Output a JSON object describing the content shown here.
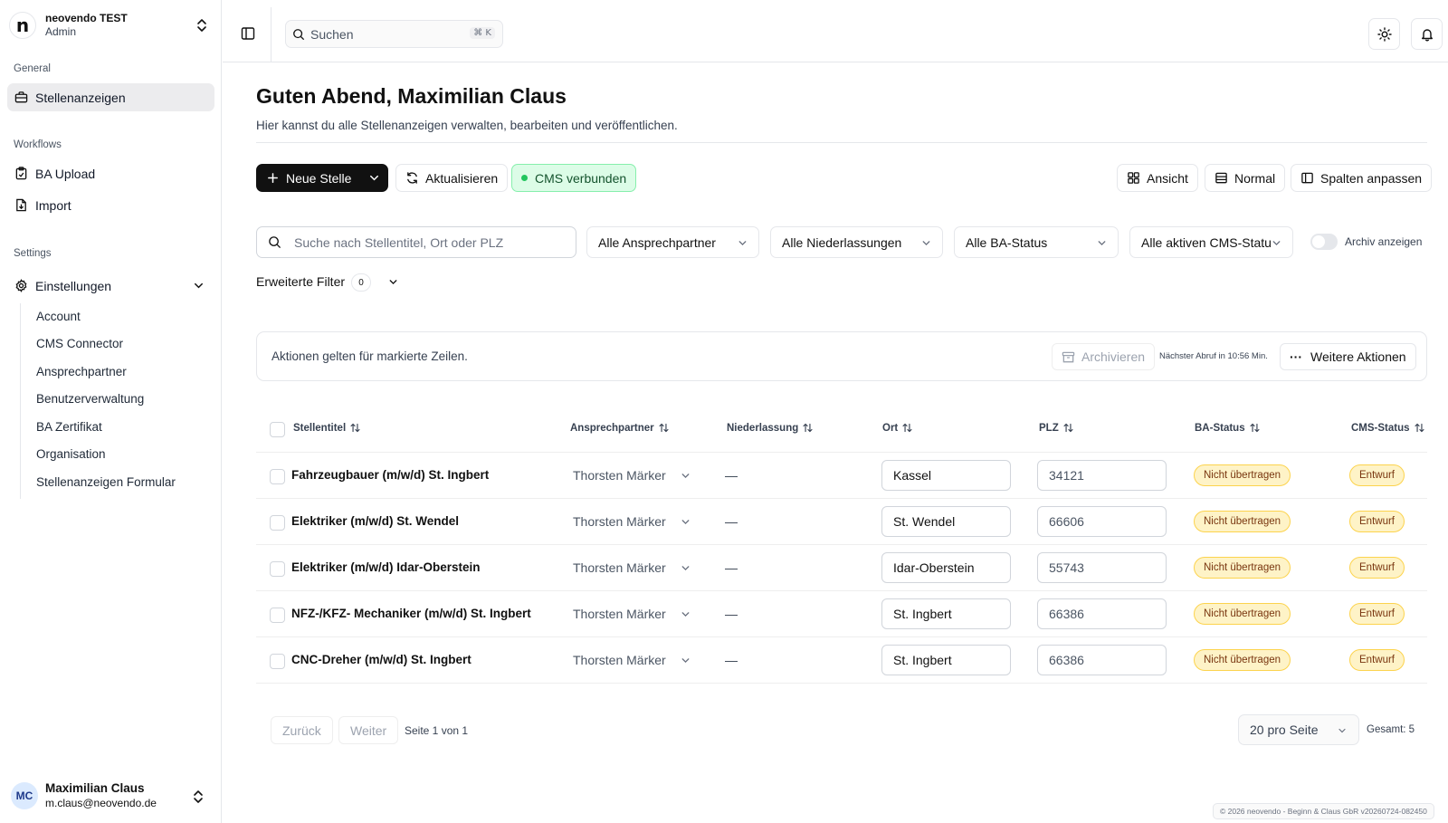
{
  "brand": {
    "name": "neovendo TEST",
    "role": "Admin",
    "logo_letter": "n"
  },
  "sidebar": {
    "general_label": "General",
    "jobs_label": "Stellenanzeigen",
    "workflows_label": "Workflows",
    "ba_upload_label": "BA Upload",
    "import_label": "Import",
    "settings_label": "Settings",
    "settings_item_label": "Einstellungen",
    "sub_items": [
      "Account",
      "CMS Connector",
      "Ansprechpartner",
      "Benutzerverwaltung",
      "BA Zertifikat",
      "Organisation",
      "Stellenanzeigen Formular"
    ]
  },
  "user": {
    "initials": "MC",
    "name": "Maximilian Claus",
    "email": "m.claus@neovendo.de"
  },
  "header": {
    "search_placeholder": "Suchen",
    "shortcut": "⌘ K"
  },
  "main": {
    "title": "Guten Abend, Maximilian Claus",
    "subtitle": "Hier kannst du alle Stellenanzeigen verwalten, bearbeiten und veröffentlichen.",
    "new_job_label": "Neue Stelle",
    "refresh_label": "Aktualisieren",
    "cms_status_label": "CMS verbunden",
    "view_label": "Ansicht",
    "density_label": "Normal",
    "columns_label": "Spalten anpassen"
  },
  "filters": {
    "search_placeholder": "Suche nach Stellentitel, Ort oder PLZ",
    "contact": "Alle Ansprechpartner",
    "branch": "Alle Niederlassungen",
    "ba_status": "Alle BA-Status",
    "cms_status": "Alle aktiven CMS-Status",
    "archive_toggle_label": "Archiv anzeigen",
    "archive_toggle_on": false,
    "advanced_label": "Erweiterte Filter",
    "advanced_count": "0"
  },
  "actions": {
    "hint": "Aktionen gelten für markierte Zeilen.",
    "archive_label": "Archivieren",
    "next_fetch": "Nächster Abruf in 10:56 Min.",
    "more_label": "Weitere Aktionen"
  },
  "table": {
    "columns": [
      "Stellentitel",
      "Ansprechpartner",
      "Niederlassung",
      "Ort",
      "PLZ",
      "BA-Status",
      "CMS-Status"
    ],
    "rows": [
      {
        "title": "Fahrzeugbauer (m/w/d) St. Ingbert",
        "contact": "Thorsten Märker",
        "branch": "—",
        "city": "Kassel",
        "plz": "34121",
        "ba_status": "Nicht übertragen",
        "cms_status": "Entwurf"
      },
      {
        "title": "Elektriker (m/w/d) St. Wendel",
        "contact": "Thorsten Märker",
        "branch": "—",
        "city": "St. Wendel",
        "plz": "66606",
        "ba_status": "Nicht übertragen",
        "cms_status": "Entwurf"
      },
      {
        "title": "Elektriker (m/w/d) Idar-Oberstein",
        "contact": "Thorsten Märker",
        "branch": "—",
        "city": "Idar-Oberstein",
        "plz": "55743",
        "ba_status": "Nicht übertragen",
        "cms_status": "Entwurf"
      },
      {
        "title": "NFZ-/KFZ- Mechaniker (m/w/d) St. Ingbert",
        "contact": "Thorsten Märker",
        "branch": "—",
        "city": "St. Ingbert",
        "plz": "66386",
        "ba_status": "Nicht übertragen",
        "cms_status": "Entwurf"
      },
      {
        "title": "CNC-Dreher (m/w/d) St. Ingbert",
        "contact": "Thorsten Märker",
        "branch": "—",
        "city": "St. Ingbert",
        "plz": "66386",
        "ba_status": "Nicht übertragen",
        "cms_status": "Entwurf"
      }
    ]
  },
  "pagination": {
    "prev_label": "Zurück",
    "next_label": "Weiter",
    "page_info": "Seite 1 von 1",
    "per_page": "20 pro Seite",
    "total": "Gesamt: 5"
  },
  "footer": {
    "copyright": "© 2026 neovendo - Beginn & Claus GbR v20260724-082450"
  },
  "colors": {
    "primary": "#111111",
    "cms_connected_bg": "#dcfce7",
    "badge_bg": "#fef3c7",
    "badge_border": "#fcd34d"
  }
}
